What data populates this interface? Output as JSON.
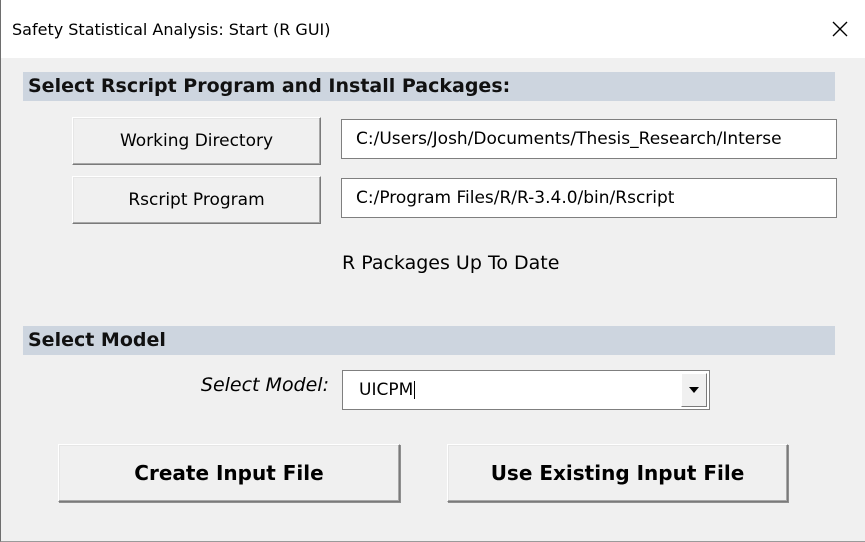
{
  "window": {
    "title": "Safety Statistical Analysis: Start (R GUI)"
  },
  "icons": {
    "close": "close-icon",
    "dropdown": "chevron-down-icon"
  },
  "colors": {
    "section_header_bg": "#cdd5df",
    "dialog_bg": "#f0f0f0"
  },
  "section_setup": {
    "header": "Select Rscript Program and Install Packages:",
    "working_directory_button": "Working Directory",
    "working_directory_value": "C:/Users/Josh/Documents/Thesis_Research/Interse",
    "rscript_button": "Rscript Program",
    "rscript_value": "C:/Program Files/R/R-3.4.0/bin/Rscript",
    "status": "R Packages Up To Date"
  },
  "section_model": {
    "header": "Select Model",
    "label": "Select Model:",
    "selected": "UICPM"
  },
  "actions": {
    "create_input": "Create Input File",
    "use_existing": "Use Existing Input File"
  }
}
